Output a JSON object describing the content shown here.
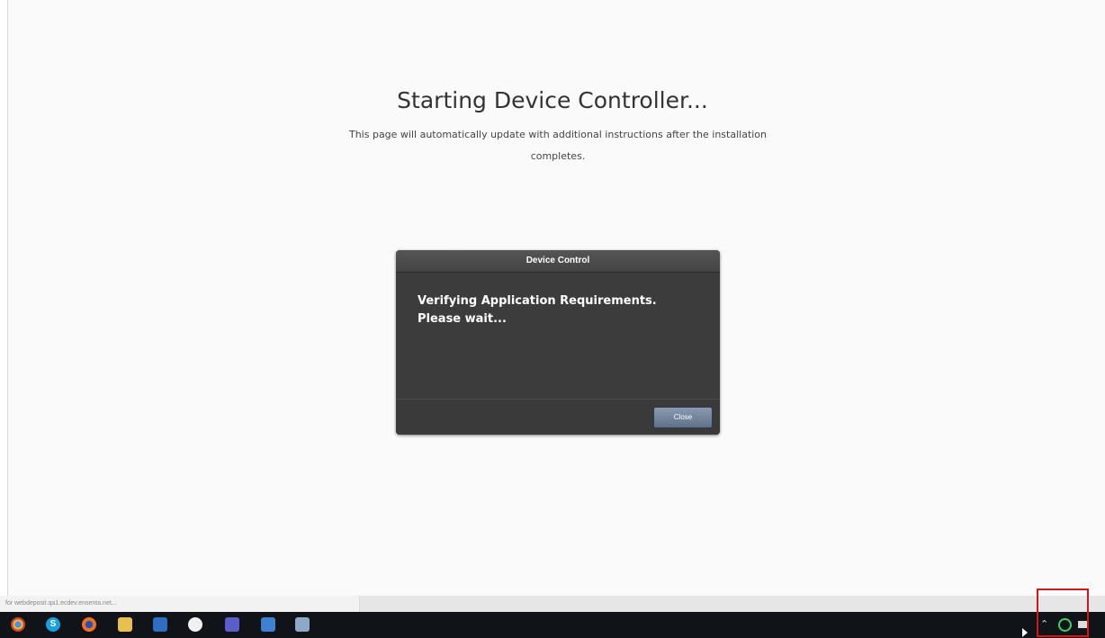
{
  "page": {
    "heading": "Starting Device Controller...",
    "subtext": "This page will automatically update with additional instructions after the installation completes."
  },
  "dialog": {
    "title": "Device Control",
    "message_line1": "Verifying Application Requirements.",
    "message_line2": "Please wait...",
    "close_label": "Close"
  },
  "statusbar": {
    "url_text": "for webdeposit.qa1.ecdev.ensenta.net..."
  },
  "taskbar": {
    "icons": [
      "chrome-icon",
      "skype-icon",
      "firefox-icon",
      "file-explorer-icon",
      "mail-icon",
      "settings-icon",
      "teams-icon",
      "remote-desktop-icon",
      "notepad-icon"
    ],
    "tray_icons": [
      "tray-arrow-icon",
      "device-controller-tray-icon",
      "network-icon"
    ]
  },
  "colors": {
    "dialog_bg": "#3c3c3c",
    "close_button": "#6f8198",
    "highlight": "#d01818",
    "taskbar": "#101418"
  }
}
